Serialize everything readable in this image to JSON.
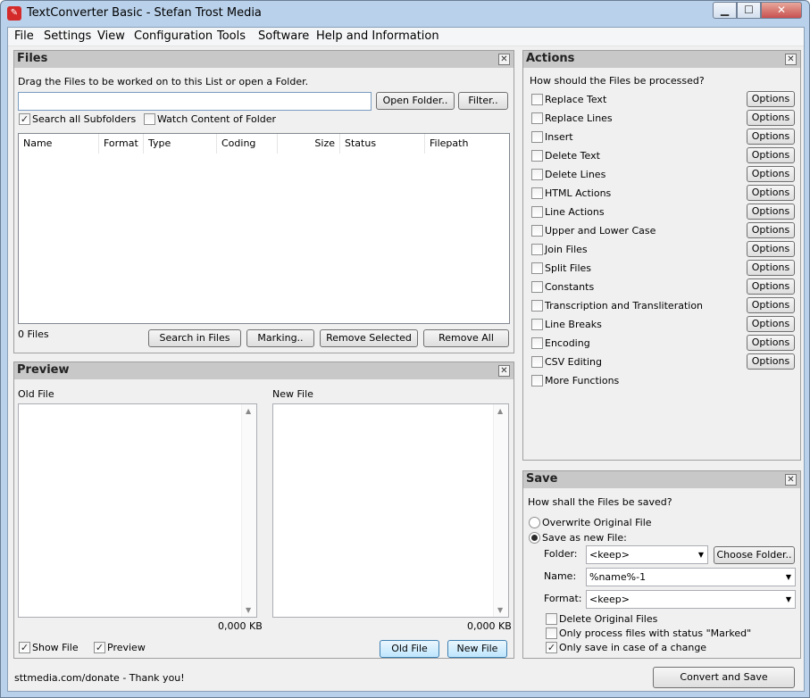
{
  "window": {
    "title": "TextConverter Basic - Stefan Trost Media",
    "min_glyph": "▁",
    "max_glyph": "☐",
    "close_glyph": "✕"
  },
  "menu": [
    "File",
    "Settings",
    "View",
    "Configuration",
    "Tools",
    "Software",
    "Help and Information"
  ],
  "files": {
    "title": "Files",
    "instruction": "Drag the Files to be worked on to this List or open a Folder.",
    "path_value": "",
    "open_folder": "Open Folder..",
    "filter": "Filter..",
    "search_subfolders": {
      "label": "Search all Subfolders",
      "checked": true
    },
    "watch_folder": {
      "label": "Watch Content of Folder",
      "checked": false
    },
    "columns": [
      "Name",
      "Format",
      "Type",
      "Coding",
      "Size",
      "Status",
      "Filepath"
    ],
    "count": "0 Files",
    "search_in_files": "Search in Files",
    "marking": "Marking..",
    "remove_selected": "Remove Selected",
    "remove_all": "Remove All"
  },
  "preview": {
    "title": "Preview",
    "old_file_label": "Old File",
    "new_file_label": "New File",
    "old_size": "0,000 KB",
    "new_size": "0,000 KB",
    "show_file": {
      "label": "Show File",
      "checked": true
    },
    "preview_cb": {
      "label": "Preview",
      "checked": true
    },
    "old_file_btn": "Old File",
    "new_file_btn": "New File"
  },
  "actions": {
    "title": "Actions",
    "question": "How should the Files be processed?",
    "options_label": "Options",
    "items": [
      {
        "label": "Replace Text",
        "options": true
      },
      {
        "label": "Replace Lines",
        "options": true
      },
      {
        "label": "Insert",
        "options": true
      },
      {
        "label": "Delete Text",
        "options": true
      },
      {
        "label": "Delete Lines",
        "options": true
      },
      {
        "label": "HTML Actions",
        "options": true
      },
      {
        "label": "Line Actions",
        "options": true
      },
      {
        "label": "Upper and Lower Case",
        "options": true
      },
      {
        "label": "Join Files",
        "options": true
      },
      {
        "label": "Split Files",
        "options": true
      },
      {
        "label": "Constants",
        "options": true
      },
      {
        "label": "Transcription and Transliteration",
        "options": true
      },
      {
        "label": "Line Breaks",
        "options": true
      },
      {
        "label": "Encoding",
        "options": true
      },
      {
        "label": "CSV Editing",
        "options": true
      },
      {
        "label": "More Functions",
        "options": false
      }
    ]
  },
  "save": {
    "title": "Save",
    "question": "How shall the Files be saved?",
    "overwrite": {
      "label": "Overwrite Original File",
      "selected": false
    },
    "save_new": {
      "label": "Save as new File:",
      "selected": true
    },
    "folder_label": "Folder:",
    "folder_value": "<keep>",
    "choose_folder": "Choose Folder..",
    "name_label": "Name:",
    "name_value": "%name%-1",
    "format_label": "Format:",
    "format_value": "<keep>",
    "delete_original": {
      "label": "Delete Original Files",
      "checked": false
    },
    "only_marked": {
      "label": "Only process files with status \"Marked\"",
      "checked": false
    },
    "only_change": {
      "label": "Only save in case of a change",
      "checked": true
    }
  },
  "status": {
    "text": "sttmedia.com/donate - Thank you!",
    "convert_button": "Convert and Save"
  }
}
